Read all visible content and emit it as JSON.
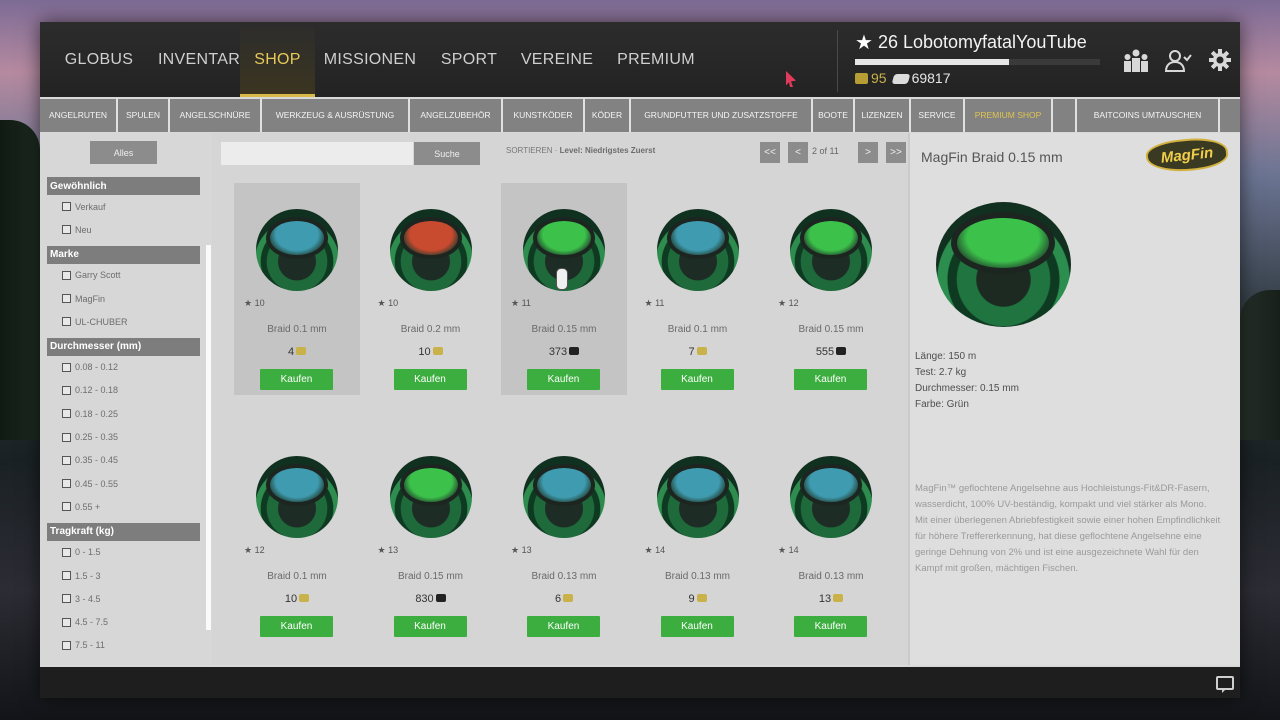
{
  "nav": {
    "tabs": [
      {
        "label": "GLOBUS",
        "active": false
      },
      {
        "label": "INVENTAR",
        "active": false
      },
      {
        "label": "SHOP",
        "active": true
      },
      {
        "label": "MISSIONEN",
        "active": false
      },
      {
        "label": "SPORT",
        "active": false
      },
      {
        "label": "VEREINE",
        "active": false
      },
      {
        "label": "PREMIUM",
        "active": false
      }
    ]
  },
  "player": {
    "level": "26",
    "name": "LobotomyfatalYouTube",
    "xp_progress": 0.63,
    "baitcoins": "95",
    "cash": "69817"
  },
  "toolbar_icons": [
    "leaderboard-icon",
    "friends-icon",
    "settings-icon"
  ],
  "categories": [
    {
      "label": "ANGELRUTEN",
      "active": false
    },
    {
      "label": "SPULEN",
      "active": false
    },
    {
      "label": "ANGELSCHNÜRE",
      "active": false
    },
    {
      "label": "WERKZEUG & AUSRÜSTUNG",
      "active": false
    },
    {
      "label": "ANGELZUBEHÖR",
      "active": false
    },
    {
      "label": "KUNSTKÖDER",
      "active": false
    },
    {
      "label": "KÖDER",
      "active": false
    },
    {
      "label": "GRUNDFUTTER UND ZUSATZSTOFFE",
      "active": false
    },
    {
      "label": "BOOTE",
      "active": false
    },
    {
      "label": "LIZENZEN",
      "active": false
    },
    {
      "label": "SERVICE",
      "active": false
    },
    {
      "label": "PREMIUM SHOP",
      "active": true
    },
    {
      "label": "",
      "active": false
    },
    {
      "label": "BAITCOINS UMTAUSCHEN",
      "active": false
    }
  ],
  "filters": {
    "all_label": "Alles",
    "groups": [
      {
        "title": "Gewöhnlich",
        "items": [
          "Verkauf",
          "Neu"
        ]
      },
      {
        "title": "Marke",
        "items": [
          "Garry Scott",
          "MagFin",
          "UL-CHUBER"
        ]
      },
      {
        "title": "Durchmesser (mm)",
        "items": [
          "0.08 - 0.12",
          "0.12 - 0.18",
          "0.18 - 0.25",
          "0.25 - 0.35",
          "0.35 - 0.45",
          "0.45 - 0.55",
          "0.55 +"
        ]
      },
      {
        "title": "Tragkraft (kg)",
        "items": [
          "0 - 1.5",
          "1.5 - 3",
          "3 - 4.5",
          "4.5 - 7.5",
          "7.5 - 11"
        ]
      }
    ]
  },
  "search": {
    "placeholder": "",
    "button": "Suche",
    "sort_label": "SORTIEREN",
    "sort_value": "Level: Niedrigstes Zuerst"
  },
  "pagination": {
    "first": "<<",
    "prev": "<",
    "info": "2 of 11",
    "next": ">",
    "last": ">>"
  },
  "products": [
    {
      "level": "10",
      "name": "Braid 0.1 mm",
      "price": "4",
      "currency": "baitcoins",
      "label_color": "#3f9bb0",
      "selected": true
    },
    {
      "level": "10",
      "name": "Braid 0.2 mm",
      "price": "10",
      "currency": "baitcoins",
      "label_color": "#c84a2f",
      "selected": false
    },
    {
      "level": "11",
      "name": "Braid 0.15 mm",
      "price": "373",
      "currency": "cash",
      "label_color": "#3cc24b",
      "selected": true
    },
    {
      "level": "11",
      "name": "Braid 0.1 mm",
      "price": "7",
      "currency": "baitcoins",
      "label_color": "#3f9bb0",
      "selected": false
    },
    {
      "level": "12",
      "name": "Braid 0.15 mm",
      "price": "555",
      "currency": "cash",
      "label_color": "#3cc24b",
      "selected": false
    },
    {
      "level": "12",
      "name": "Braid 0.1 mm",
      "price": "10",
      "currency": "baitcoins",
      "label_color": "#3f9bb0",
      "selected": false
    },
    {
      "level": "13",
      "name": "Braid 0.15 mm",
      "price": "830",
      "currency": "cash",
      "label_color": "#3cc24b",
      "selected": false
    },
    {
      "level": "13",
      "name": "Braid 0.13 mm",
      "price": "6",
      "currency": "baitcoins",
      "label_color": "#3f9bb0",
      "selected": false
    },
    {
      "level": "14",
      "name": "Braid 0.13 mm",
      "price": "9",
      "currency": "baitcoins",
      "label_color": "#3f9bb0",
      "selected": false
    },
    {
      "level": "14",
      "name": "Braid 0.13 mm",
      "price": "13",
      "currency": "baitcoins",
      "label_color": "#3f9bb0",
      "selected": false
    }
  ],
  "buy_label": "Kaufen",
  "detail": {
    "title": "MagFin Braid 0.15 mm",
    "brand_logo": "MagFin",
    "attributes": [
      "Länge: 150 m",
      "Test: 2.7 kg",
      "Durchmesser: 0.15 mm",
      "Farbe: Grün"
    ],
    "description": "MagFin™ geflochtene Angelsehne aus Hochleistungs-Fit&DR-Fasern, wasserdicht, 100% UV-beständig, kompakt und viel stärker als Mono. Mit einer überlegenen Abriebfestigkeit sowie einer hohen Empfindlichkeit für höhere Treffererkennung, hat diese geflochtene Angelsehne eine geringe Dehnung von 2% und ist eine ausgezeichnete Wahl für den Kampf mit großen, mächtigen Fischen."
  },
  "colors": {
    "accent": "#d8b94a",
    "buy_button": "#3cae3f",
    "topbar": "#262626"
  }
}
